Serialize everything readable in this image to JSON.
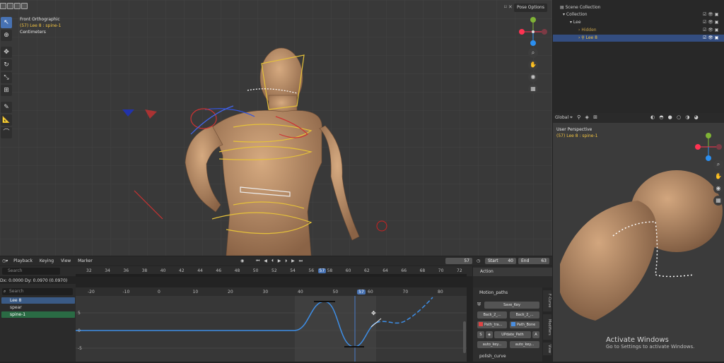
{
  "viewport": {
    "view_name": "Front Orthographic",
    "object_label": "(57) Lee 8 : spine-1",
    "units": "Centimeters",
    "pose_options": "Pose Options"
  },
  "viewport2": {
    "view_name": "User Perspective",
    "object_label": "(57) Lee 8 : spine-1",
    "orientation": "Global"
  },
  "outliner": {
    "scene_collection": "Scene Collection",
    "collection": "Collection",
    "items": [
      "Lee",
      "Hidden",
      "Lee 8"
    ]
  },
  "timeline": {
    "menus": [
      "Playback",
      "Keying",
      "View",
      "Marker"
    ],
    "current_frame": "57",
    "start_label": "Start",
    "start": "40",
    "end_label": "End",
    "end": "63",
    "ticks": [
      "32",
      "34",
      "36",
      "38",
      "40",
      "42",
      "44",
      "46",
      "48",
      "50",
      "52",
      "54",
      "56",
      "57",
      "58",
      "60",
      "62",
      "64",
      "66",
      "68",
      "70",
      "72"
    ]
  },
  "graph_editor": {
    "status": "Dx: 0.0000  Dy: 0.0970 (0.0970)",
    "search_placeholder": "Search",
    "ticks": [
      "-20",
      "-10",
      "0",
      "10",
      "20",
      "30",
      "40",
      "50",
      "57",
      "60",
      "70",
      "80"
    ],
    "y_ticks": [
      "5",
      "0",
      "-5"
    ],
    "channels": [
      "Lee 8",
      "spear",
      "spine-1"
    ]
  },
  "side_panel": {
    "action_label": "Action",
    "motion_paths_label": "Motion_paths",
    "save_key": "Save_Key",
    "back1": "Back_2_...",
    "back2": "Back_2_...",
    "path_tra": "Path_tra...",
    "path_bone": "Path_Bone",
    "s_label": "S",
    "update_path": "UPdate_Path",
    "a_label": "A",
    "auto_key1": "auto_key...",
    "auto_key2": "auto_key...",
    "polish_curve": "polish_curve",
    "tabs": [
      "F-Curve",
      "Modifiers",
      "View"
    ]
  },
  "watermark": {
    "line1": "Activate Windows",
    "line2": "Go to Settings to activate Windows."
  },
  "colors": {
    "accent": "#4772b3",
    "curve": "#3e8ee6",
    "yellow": "#e6c23a"
  }
}
